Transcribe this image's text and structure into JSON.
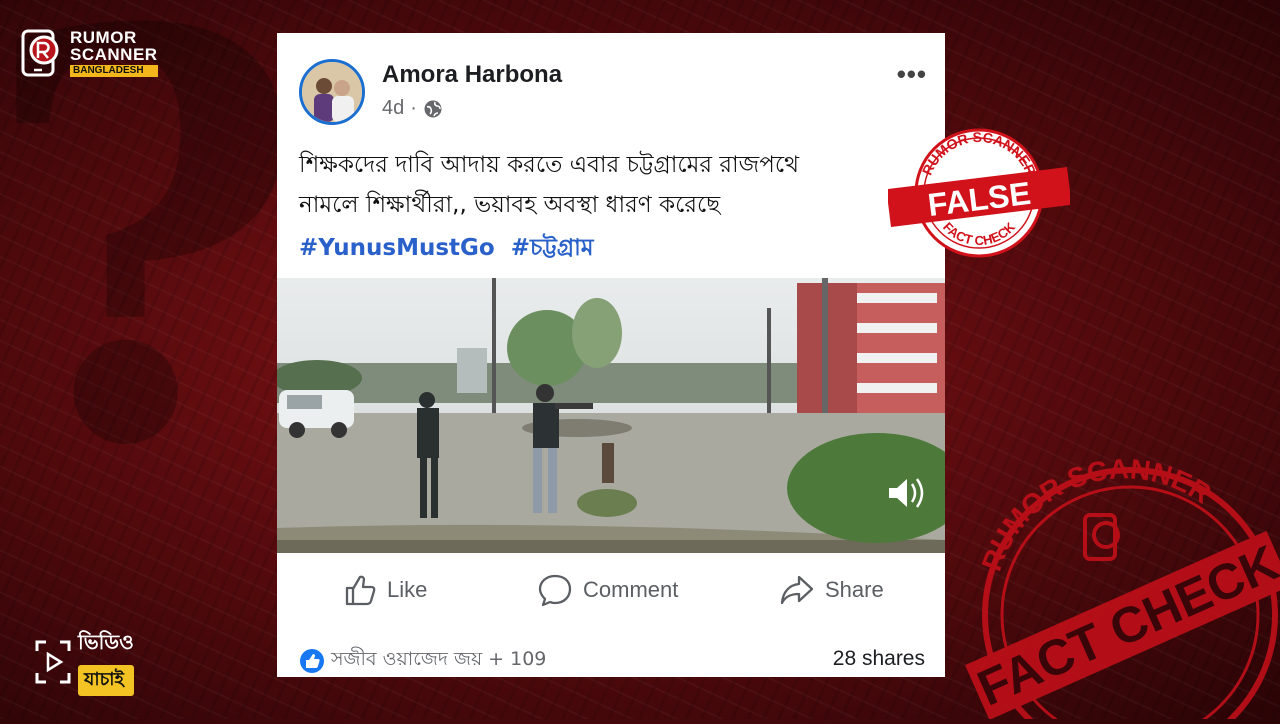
{
  "brand": {
    "line1": "RUMOR",
    "line2": "SCANNER",
    "line3": "BANGLADESH"
  },
  "video_logo": {
    "line1": "ভিডিও",
    "line2": "যাচাই"
  },
  "post": {
    "author": "Amora Harbona",
    "time": "4d",
    "separator": "·",
    "text": "শিক্ষকদের দাবি আদায় করতে এবার চট্টগ্রামের রাজপথে\nনামলে শিক্ষার্থীরা,, ভয়াবহ অবস্থা ধারণ করেছে",
    "hashtags": [
      "#YunusMustGo",
      "#চট্টগ্রাম"
    ],
    "actions": {
      "like": "Like",
      "comment": "Comment",
      "share": "Share"
    },
    "reactions_text": "সজীব ওয়াজেদ জয় + 109",
    "shares_text": "28 shares"
  },
  "stamp_false": {
    "top": "RUMOR SCANNER",
    "label": "FALSE",
    "bottom": "FACT CHECK"
  },
  "stamp_big": {
    "top": "RUMOR SCANNER",
    "label": "FACT CHECK"
  },
  "icons": [
    "rumor-scanner-logo-icon",
    "globe-icon",
    "more-options-icon",
    "like-icon",
    "comment-icon",
    "share-icon",
    "speaker-icon",
    "like-reaction-icon",
    "play-icon"
  ],
  "colors": {
    "accent_red": "#d1121b",
    "link_blue": "#2960c9",
    "brand_yellow": "#f3b71b"
  }
}
